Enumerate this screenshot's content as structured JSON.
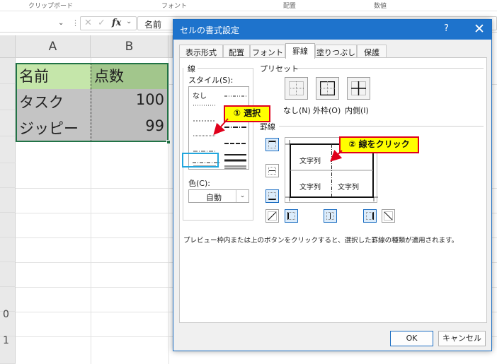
{
  "ribbon_group_labels": [
    "クリップボード",
    "フォント",
    "配置",
    "数値"
  ],
  "formula_bar": {
    "namebox_dropdown": "⌄",
    "separator": "⋮",
    "cancel_glyph": "✕",
    "enter_glyph": "✓",
    "fx_label": "fx",
    "fx_dropdown": "⌄",
    "value": "名前"
  },
  "spreadsheet": {
    "columns": [
      "A",
      "B"
    ],
    "rows": [
      {
        "a": "名前",
        "b": "点数"
      },
      {
        "a": "タスク",
        "b": "100"
      },
      {
        "a": "ジッピー",
        "b": "99"
      }
    ],
    "partial_row_labels": [
      "0",
      "1"
    ]
  },
  "dialog": {
    "title": "セルの書式設定",
    "help_label": "?",
    "close_label": "✕",
    "tabs": [
      "表示形式",
      "配置",
      "フォント",
      "罫線",
      "塗りつぶし",
      "保護"
    ],
    "active_tab": "罫線",
    "line_group_label": "線",
    "style_label": "スタイル(S):",
    "none_label": "なし",
    "color_label": "色(C):",
    "color_value": "自動",
    "color_dropdown": "⌄",
    "preset_group_label": "プリセット",
    "presets": [
      {
        "label": "なし(N)",
        "icon": "preset-none-icon"
      },
      {
        "label": "外枠(O)",
        "icon": "preset-outline-icon"
      },
      {
        "label": "内側(I)",
        "icon": "preset-inside-icon"
      }
    ],
    "border_group_label": "罫線",
    "preview_cell_text": "文字列",
    "hint": "プレビュー枠内または上のボタンをクリックすると、選択した罫線の種類が適用されます。",
    "ok_label": "OK",
    "cancel_label": "キャンセル"
  },
  "callouts": {
    "select": "① 選択",
    "click_line": "② 線をクリック"
  },
  "colors": {
    "dialog_title_bg": "#1e73cc",
    "header_green": "#c5e6aa",
    "header_green_dark": "#a2c68c",
    "data_gray": "#c4c4c4",
    "selection_green": "#217346",
    "callout_fill": "#ffff00",
    "callout_border": "#e0001b",
    "highlight_blue": "#22a6dd"
  }
}
